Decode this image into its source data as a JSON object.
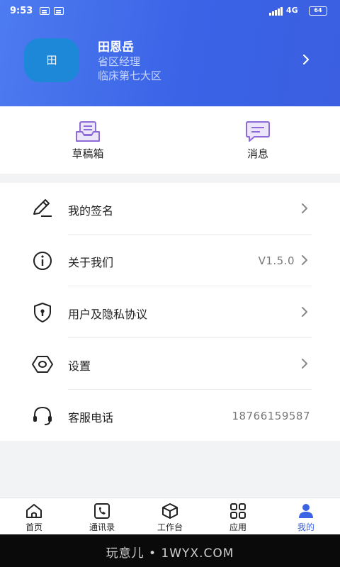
{
  "status_bar": {
    "time": "9:53",
    "network": "4G",
    "battery": "64"
  },
  "profile": {
    "avatar_text": "田",
    "name": "田恩岳",
    "role": "省区经理",
    "area": "临床第七大区"
  },
  "quick_actions": [
    {
      "label": "草稿箱",
      "icon": "draft-box-icon"
    },
    {
      "label": "消息",
      "icon": "message-icon"
    }
  ],
  "menu": [
    {
      "label": "我的签名",
      "icon": "signature-icon",
      "value": ""
    },
    {
      "label": "关于我们",
      "icon": "info-icon",
      "value": "V1.5.0"
    },
    {
      "label": "用户及隐私协议",
      "icon": "shield-icon",
      "value": ""
    },
    {
      "label": "设置",
      "icon": "settings-hexagon-icon",
      "value": ""
    },
    {
      "label": "客服电话",
      "icon": "headset-icon",
      "value": "18766159587"
    }
  ],
  "tabs": [
    {
      "label": "首页",
      "icon": "home-icon"
    },
    {
      "label": "通讯录",
      "icon": "contacts-icon"
    },
    {
      "label": "工作台",
      "icon": "workbench-icon"
    },
    {
      "label": "应用",
      "icon": "apps-icon"
    },
    {
      "label": "我的",
      "icon": "user-icon",
      "active": true
    }
  ],
  "watermark": "玩意儿 • 1WYX.COM",
  "colors": {
    "header": "#3a63e6",
    "accent": "#3a63e6",
    "quick_icon": "#8e6bd6",
    "avatar": "#1e88d8"
  }
}
